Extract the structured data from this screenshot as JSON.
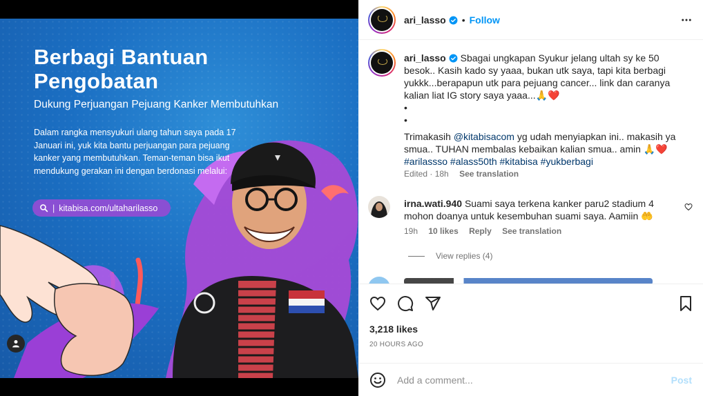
{
  "post": {
    "title_line1": "Berbagi Bantuan",
    "title_line2": "Pengobatan",
    "subtitle": "Dukung Perjuangan Pejuang Kanker Membutuhkan",
    "body": "Dalam rangka mensyukuri ulang tahun saya pada 17 Januari ini, yuk kita bantu perjuangan para pejuang kanker yang membutuhkan. Teman-teman bisa ikut mendukung gerakan ini dengan berdonasi melalui:",
    "url": "kitabisa.com/ultaharilasso"
  },
  "header": {
    "username": "ari_lasso",
    "separator": "•",
    "follow_label": "Follow"
  },
  "caption": {
    "username": "ari_lasso",
    "line1": "Sbagai ungkapan Syukur jelang ultah sy ke 50 besok.. Kasih kado sy yaaa, bukan utk saya, tapi kita berbagi yukkk...berapapun utk para pejuang cancer... link dan caranya kalian liat IG story saya yaaa...🙏❤️",
    "bullet1": "•",
    "bullet2": "•",
    "line2_prefix": "Trimakasih ",
    "mention": "@kitabisacom",
    "line2_suffix": " yg udah menyiapkan ini.. makasih ya smua.. TUHAN membalas kebaikan kalian smua.. amin 🙏❤️",
    "hashtags": "#arilassso #alass50th #kitabisa #yukberbagi",
    "edited": "Edited · 18h",
    "see_translation": "See translation"
  },
  "comment": {
    "username": "irna.wati.940",
    "text": "Suami saya terkena kanker paru2 stadium 4 mohon doanya untuk kesembuhan suami saya. Aamiin 🤲",
    "time": "19h",
    "likes": "10 likes",
    "reply": "Reply",
    "see_translation": "See translation",
    "view_replies": "View replies (4)"
  },
  "actions": {
    "likes": "3,218 likes",
    "timestamp": "20 HOURS AGO"
  },
  "add_comment": {
    "placeholder": "Add a comment...",
    "post_label": "Post"
  },
  "colors": {
    "accent": "#0095f6",
    "post_disabled": "#b2dffc",
    "poster_blue": "#1b6fc3",
    "url_pill": "#8a4fd3"
  }
}
